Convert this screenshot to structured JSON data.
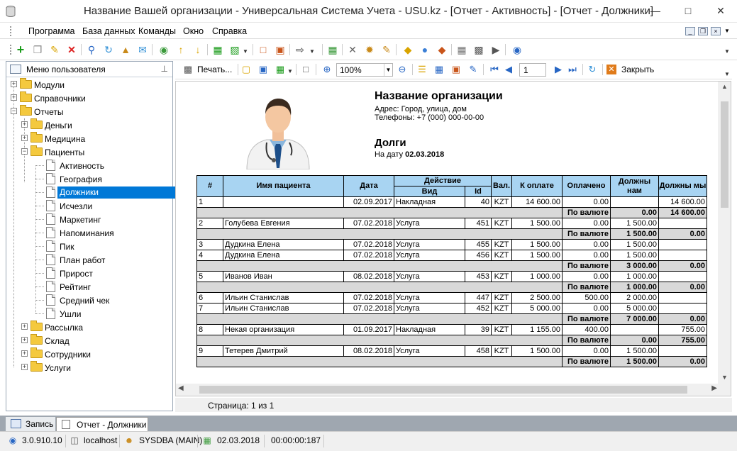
{
  "window": {
    "title": "Название Вашей организации - Универсальная Система Учета - USU.kz - [Отчет - Активность] - [Отчет - Должники]"
  },
  "menu": [
    "Программа",
    "База данных",
    "Команды",
    "Окно",
    "Справка"
  ],
  "left_panel": {
    "title": "Меню пользователя",
    "tree": [
      {
        "label": "Модули"
      },
      {
        "label": "Справочники"
      },
      {
        "label": "Отчеты"
      },
      {
        "label": "Деньги"
      },
      {
        "label": "Медицина"
      },
      {
        "label": "Пациенты"
      },
      {
        "label": "Активность"
      },
      {
        "label": "География"
      },
      {
        "label": "Должники"
      },
      {
        "label": "Исчезли"
      },
      {
        "label": "Маркетинг"
      },
      {
        "label": "Напоминания"
      },
      {
        "label": "Пик"
      },
      {
        "label": "План работ"
      },
      {
        "label": "Прирост"
      },
      {
        "label": "Рейтинг"
      },
      {
        "label": "Средний чек"
      },
      {
        "label": "Ушли"
      },
      {
        "label": "Рассылка"
      },
      {
        "label": "Склад"
      },
      {
        "label": "Сотрудники"
      },
      {
        "label": "Услуги"
      }
    ]
  },
  "report_toolbar": {
    "print": "Печать...",
    "zoom": "100%",
    "page": "1",
    "close": "Закрыть"
  },
  "report": {
    "org_name": "Название организации",
    "address": "Адрес: Город, улица, дом",
    "phone": "Телефоны: +7 (000) 000-00-00",
    "title": "Долги",
    "date_label": "На дату",
    "date_value": "02.03.2018",
    "headers": {
      "num": "#",
      "patient": "Имя пациента",
      "date": "Дата",
      "action": "Действие",
      "kind": "Вид",
      "id": "Id",
      "currency": "Вал.",
      "to_pay": "К оплате",
      "paid": "Оплачено",
      "owe_us": "Должны нам",
      "we_owe": "Должны мы"
    },
    "sum_label": "По валюте",
    "rows": [
      {
        "type": "row",
        "n": "1",
        "name": "",
        "date": "02.09.2017",
        "kind": "Накладная",
        "id": "40",
        "cur": "KZT",
        "pay": "14 600.00",
        "paid": "0.00",
        "owe": "",
        "weowe": "14 600.00"
      },
      {
        "type": "sum",
        "owe": "0.00",
        "weowe": "14 600.00"
      },
      {
        "type": "row",
        "n": "2",
        "name": "Голубева Евгения",
        "date": "07.02.2018",
        "kind": "Услуга",
        "id": "451",
        "cur": "KZT",
        "pay": "1 500.00",
        "paid": "0.00",
        "owe": "1 500.00",
        "weowe": ""
      },
      {
        "type": "sum",
        "owe": "1 500.00",
        "weowe": "0.00"
      },
      {
        "type": "row",
        "n": "3",
        "name": "Дудкина Елена",
        "date": "07.02.2018",
        "kind": "Услуга",
        "id": "455",
        "cur": "KZT",
        "pay": "1 500.00",
        "paid": "0.00",
        "owe": "1 500.00",
        "weowe": ""
      },
      {
        "type": "row",
        "n": "4",
        "name": "Дудкина Елена",
        "date": "07.02.2018",
        "kind": "Услуга",
        "id": "456",
        "cur": "KZT",
        "pay": "1 500.00",
        "paid": "0.00",
        "owe": "1 500.00",
        "weowe": ""
      },
      {
        "type": "sum",
        "owe": "3 000.00",
        "weowe": "0.00"
      },
      {
        "type": "row",
        "n": "5",
        "name": "Иванов Иван",
        "date": "08.02.2018",
        "kind": "Услуга",
        "id": "453",
        "cur": "KZT",
        "pay": "1 000.00",
        "paid": "0.00",
        "owe": "1 000.00",
        "weowe": ""
      },
      {
        "type": "sum",
        "owe": "1 000.00",
        "weowe": "0.00"
      },
      {
        "type": "row",
        "n": "6",
        "name": "Ильин Станислав",
        "date": "07.02.2018",
        "kind": "Услуга",
        "id": "447",
        "cur": "KZT",
        "pay": "2 500.00",
        "paid": "500.00",
        "owe": "2 000.00",
        "weowe": ""
      },
      {
        "type": "row",
        "n": "7",
        "name": "Ильин Станислав",
        "date": "07.02.2018",
        "kind": "Услуга",
        "id": "452",
        "cur": "KZT",
        "pay": "5 000.00",
        "paid": "0.00",
        "owe": "5 000.00",
        "weowe": ""
      },
      {
        "type": "sum",
        "owe": "7 000.00",
        "weowe": "0.00"
      },
      {
        "type": "row",
        "n": "8",
        "name": "Некая организация",
        "date": "01.09.2017",
        "kind": "Накладная",
        "id": "39",
        "cur": "KZT",
        "pay": "1 155.00",
        "paid": "400.00",
        "owe": "",
        "weowe": "755.00"
      },
      {
        "type": "sum",
        "owe": "0.00",
        "weowe": "755.00"
      },
      {
        "type": "row",
        "n": "9",
        "name": "Тетерев Дмитрий",
        "date": "08.02.2018",
        "kind": "Услуга",
        "id": "458",
        "cur": "KZT",
        "pay": "1 500.00",
        "paid": "0.00",
        "owe": "1 500.00",
        "weowe": ""
      },
      {
        "type": "sum",
        "owe": "1 500.00",
        "weowe": "0.00"
      }
    ]
  },
  "page_status": "Страница: 1 из 1",
  "tabs": [
    "Запись",
    "Отчет - Должники"
  ],
  "statusbar": {
    "version": "3.0.910.10",
    "host": "localhost",
    "user": "SYSDBA (MAIN)",
    "date": "02.03.2018",
    "timer": "00:00:00:187"
  }
}
